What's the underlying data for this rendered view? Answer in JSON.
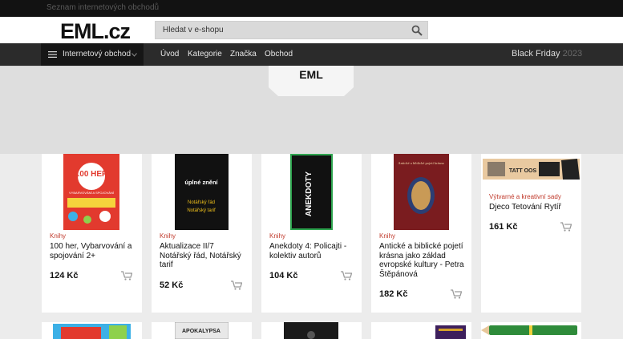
{
  "topbar": {
    "text": "Seznam internetových obchodů"
  },
  "header": {
    "logo": "EML.cz",
    "search_placeholder": "Hledat v e-shopu"
  },
  "nav": {
    "menu_label": "Internetový obchod",
    "items": [
      "Úvod",
      "Kategorie",
      "Značka",
      "Obchod"
    ],
    "promo_label": "Black Friday",
    "promo_year": "2023"
  },
  "section": {
    "title": "EML"
  },
  "products": [
    {
      "category": "Knihy",
      "name": "100 her, Vybarvování a spojování 2+",
      "price": "124 Kč"
    },
    {
      "category": "Knihy",
      "name": "Aktualizace II/7 Notářský řád, Notářský tarif",
      "price": "52 Kč"
    },
    {
      "category": "Knihy",
      "name": "Anekdoty 4: Policajti - kolektiv autorů",
      "price": "104 Kč"
    },
    {
      "category": "Knihy",
      "name": "Antické a biblické pojetí krásna jako základ evropské kultury - Petra Štěpánová",
      "price": "182 Kč"
    },
    {
      "category": "Výtvarné a kreativní sady",
      "name": "Djeco Tetování Rytíř",
      "price": "161 Kč"
    }
  ],
  "covers": {
    "c1": {
      "title": "100 HER",
      "subtitle": "VYBARVOVÁNÍ A SPOJOVÁNÍ"
    },
    "c2": {
      "title": "úplné znění",
      "line1": "Notářský řád",
      "line2": "Notářský tarif"
    },
    "c3": {
      "text": "ANEKDOTY"
    },
    "c4": {
      "title": "Antické a biblické pojetí krásna"
    },
    "c5": {
      "text": "TATT OOS"
    },
    "r2": {
      "text": "APOKALYPSA"
    }
  },
  "colors": {
    "accent": "#c0392b",
    "nav": "#2b2b2b",
    "topbar": "#121212",
    "cart": "#9a9a9a"
  }
}
